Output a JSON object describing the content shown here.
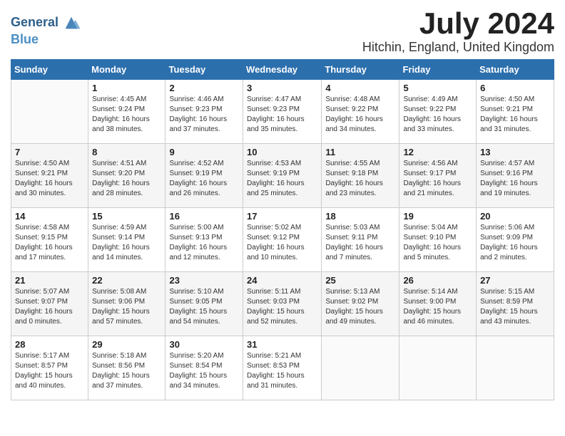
{
  "header": {
    "logo_line1": "General",
    "logo_line2": "Blue",
    "month": "July 2024",
    "location": "Hitchin, England, United Kingdom"
  },
  "weekdays": [
    "Sunday",
    "Monday",
    "Tuesday",
    "Wednesday",
    "Thursday",
    "Friday",
    "Saturday"
  ],
  "weeks": [
    [
      {
        "day": "",
        "info": ""
      },
      {
        "day": "1",
        "info": "Sunrise: 4:45 AM\nSunset: 9:24 PM\nDaylight: 16 hours\nand 38 minutes."
      },
      {
        "day": "2",
        "info": "Sunrise: 4:46 AM\nSunset: 9:23 PM\nDaylight: 16 hours\nand 37 minutes."
      },
      {
        "day": "3",
        "info": "Sunrise: 4:47 AM\nSunset: 9:23 PM\nDaylight: 16 hours\nand 35 minutes."
      },
      {
        "day": "4",
        "info": "Sunrise: 4:48 AM\nSunset: 9:22 PM\nDaylight: 16 hours\nand 34 minutes."
      },
      {
        "day": "5",
        "info": "Sunrise: 4:49 AM\nSunset: 9:22 PM\nDaylight: 16 hours\nand 33 minutes."
      },
      {
        "day": "6",
        "info": "Sunrise: 4:50 AM\nSunset: 9:21 PM\nDaylight: 16 hours\nand 31 minutes."
      }
    ],
    [
      {
        "day": "7",
        "info": "Sunrise: 4:50 AM\nSunset: 9:21 PM\nDaylight: 16 hours\nand 30 minutes."
      },
      {
        "day": "8",
        "info": "Sunrise: 4:51 AM\nSunset: 9:20 PM\nDaylight: 16 hours\nand 28 minutes."
      },
      {
        "day": "9",
        "info": "Sunrise: 4:52 AM\nSunset: 9:19 PM\nDaylight: 16 hours\nand 26 minutes."
      },
      {
        "day": "10",
        "info": "Sunrise: 4:53 AM\nSunset: 9:19 PM\nDaylight: 16 hours\nand 25 minutes."
      },
      {
        "day": "11",
        "info": "Sunrise: 4:55 AM\nSunset: 9:18 PM\nDaylight: 16 hours\nand 23 minutes."
      },
      {
        "day": "12",
        "info": "Sunrise: 4:56 AM\nSunset: 9:17 PM\nDaylight: 16 hours\nand 21 minutes."
      },
      {
        "day": "13",
        "info": "Sunrise: 4:57 AM\nSunset: 9:16 PM\nDaylight: 16 hours\nand 19 minutes."
      }
    ],
    [
      {
        "day": "14",
        "info": "Sunrise: 4:58 AM\nSunset: 9:15 PM\nDaylight: 16 hours\nand 17 minutes."
      },
      {
        "day": "15",
        "info": "Sunrise: 4:59 AM\nSunset: 9:14 PM\nDaylight: 16 hours\nand 14 minutes."
      },
      {
        "day": "16",
        "info": "Sunrise: 5:00 AM\nSunset: 9:13 PM\nDaylight: 16 hours\nand 12 minutes."
      },
      {
        "day": "17",
        "info": "Sunrise: 5:02 AM\nSunset: 9:12 PM\nDaylight: 16 hours\nand 10 minutes."
      },
      {
        "day": "18",
        "info": "Sunrise: 5:03 AM\nSunset: 9:11 PM\nDaylight: 16 hours\nand 7 minutes."
      },
      {
        "day": "19",
        "info": "Sunrise: 5:04 AM\nSunset: 9:10 PM\nDaylight: 16 hours\nand 5 minutes."
      },
      {
        "day": "20",
        "info": "Sunrise: 5:06 AM\nSunset: 9:09 PM\nDaylight: 16 hours\nand 2 minutes."
      }
    ],
    [
      {
        "day": "21",
        "info": "Sunrise: 5:07 AM\nSunset: 9:07 PM\nDaylight: 16 hours\nand 0 minutes."
      },
      {
        "day": "22",
        "info": "Sunrise: 5:08 AM\nSunset: 9:06 PM\nDaylight: 15 hours\nand 57 minutes."
      },
      {
        "day": "23",
        "info": "Sunrise: 5:10 AM\nSunset: 9:05 PM\nDaylight: 15 hours\nand 54 minutes."
      },
      {
        "day": "24",
        "info": "Sunrise: 5:11 AM\nSunset: 9:03 PM\nDaylight: 15 hours\nand 52 minutes."
      },
      {
        "day": "25",
        "info": "Sunrise: 5:13 AM\nSunset: 9:02 PM\nDaylight: 15 hours\nand 49 minutes."
      },
      {
        "day": "26",
        "info": "Sunrise: 5:14 AM\nSunset: 9:00 PM\nDaylight: 15 hours\nand 46 minutes."
      },
      {
        "day": "27",
        "info": "Sunrise: 5:15 AM\nSunset: 8:59 PM\nDaylight: 15 hours\nand 43 minutes."
      }
    ],
    [
      {
        "day": "28",
        "info": "Sunrise: 5:17 AM\nSunset: 8:57 PM\nDaylight: 15 hours\nand 40 minutes."
      },
      {
        "day": "29",
        "info": "Sunrise: 5:18 AM\nSunset: 8:56 PM\nDaylight: 15 hours\nand 37 minutes."
      },
      {
        "day": "30",
        "info": "Sunrise: 5:20 AM\nSunset: 8:54 PM\nDaylight: 15 hours\nand 34 minutes."
      },
      {
        "day": "31",
        "info": "Sunrise: 5:21 AM\nSunset: 8:53 PM\nDaylight: 15 hours\nand 31 minutes."
      },
      {
        "day": "",
        "info": ""
      },
      {
        "day": "",
        "info": ""
      },
      {
        "day": "",
        "info": ""
      }
    ]
  ]
}
